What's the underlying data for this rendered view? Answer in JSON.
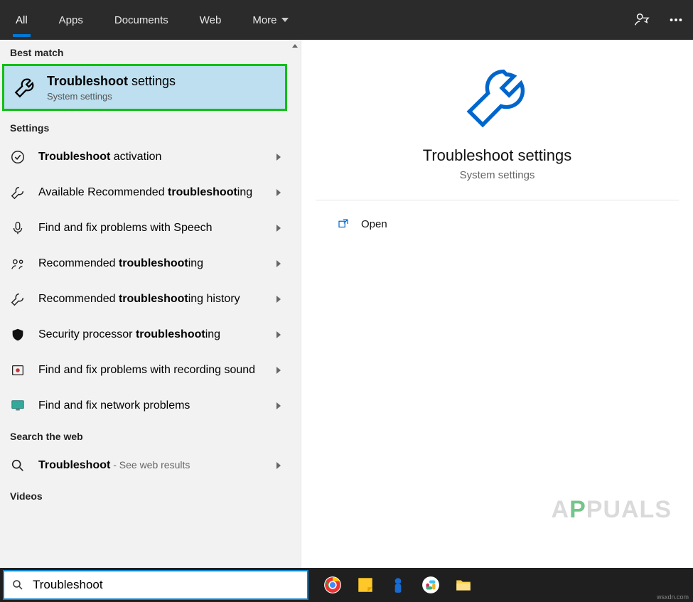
{
  "tabs": {
    "all": "All",
    "apps": "Apps",
    "documents": "Documents",
    "web": "Web",
    "more": "More"
  },
  "groups": {
    "best_match": "Best match",
    "settings": "Settings",
    "search_web": "Search the web",
    "videos": "Videos"
  },
  "best": {
    "title_b": "Troubleshoot",
    "title_r": " settings",
    "sub": "System settings"
  },
  "settings_items": [
    {
      "pre": "",
      "bold": "Troubleshoot",
      "post": " activation"
    },
    {
      "pre": "Available Recommended ",
      "bold": "troubleshoot",
      "post": "ing"
    },
    {
      "pre": "Find and fix problems with Speech",
      "bold": "",
      "post": ""
    },
    {
      "pre": "Recommended ",
      "bold": "troubleshoot",
      "post": "ing"
    },
    {
      "pre": "Recommended ",
      "bold": "troubleshoot",
      "post": "ing history"
    },
    {
      "pre": "Security processor ",
      "bold": "troubleshoot",
      "post": "ing"
    },
    {
      "pre": "Find and fix problems with recording sound",
      "bold": "",
      "post": ""
    },
    {
      "pre": "Find and fix network problems",
      "bold": "",
      "post": ""
    }
  ],
  "web_item": {
    "pre": "",
    "bold": "Troubleshoot",
    "post": "",
    "hint": " - See web results"
  },
  "preview": {
    "title": "Troubleshoot settings",
    "sub": "System settings",
    "open": "Open"
  },
  "search": {
    "value": "Troubleshoot"
  },
  "watermark": {
    "a": "A",
    "p": "P",
    "rest": "PUALS"
  },
  "wsx": "wsxdn.com"
}
